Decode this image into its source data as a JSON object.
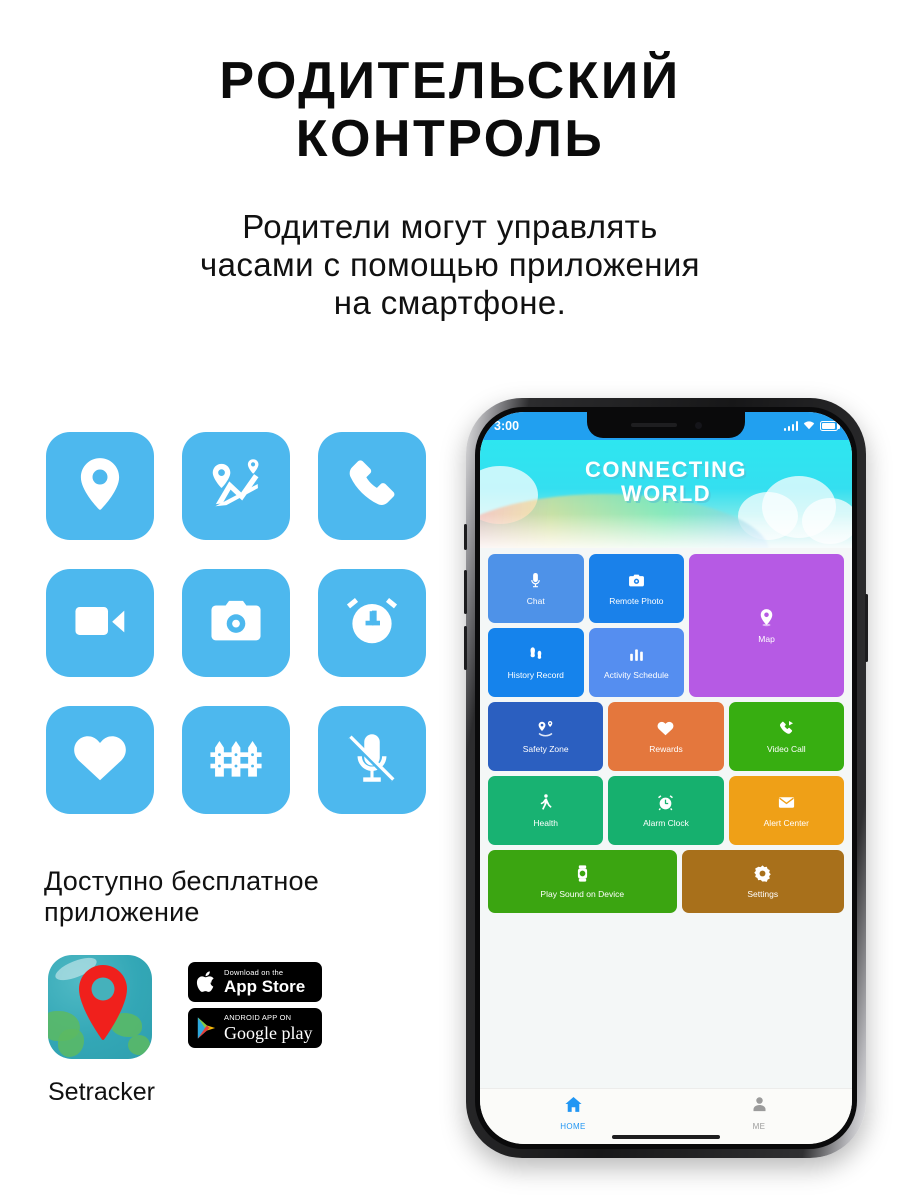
{
  "headline": {
    "line1": "РОДИТЕЛЬСКИЙ",
    "line2": "КОНТРОЛЬ"
  },
  "subhead": {
    "line1": "Родители могут управлять",
    "line2": "часами с помощью приложения",
    "line3": "на смартфоне."
  },
  "feature_icons": [
    {
      "name": "location-pin-icon",
      "label": "Location"
    },
    {
      "name": "route-map-icon",
      "label": "Route tracking"
    },
    {
      "name": "phone-call-icon",
      "label": "Phone call"
    },
    {
      "name": "video-camera-icon",
      "label": "Video call"
    },
    {
      "name": "camera-icon",
      "label": "Remote photo"
    },
    {
      "name": "alarm-clock-icon",
      "label": "Alarm clock"
    },
    {
      "name": "heart-icon",
      "label": "Health"
    },
    {
      "name": "fence-icon",
      "label": "Safety zone"
    },
    {
      "name": "microphone-off-icon",
      "label": "Silent mode"
    }
  ],
  "freeapp": {
    "title_line1": "Доступно бесплатное",
    "title_line2": "приложение",
    "app_name": "Setracker",
    "app_icon_name": "setracker-app-icon",
    "badges": [
      {
        "id": "app-store",
        "small": "Download on the",
        "big": "App Store"
      },
      {
        "id": "google-play",
        "small": "ANDROID APP ON",
        "big": "Google play"
      }
    ]
  },
  "phone": {
    "status": {
      "time": "3:00",
      "signal": "signal-bars-icon",
      "wifi": "wifi-icon",
      "battery": "battery-icon"
    },
    "banner": {
      "line1": "CONNECTING",
      "line2": "WORLD"
    },
    "tiles_group_a": [
      {
        "label": "Chat",
        "icon": "microphone-icon",
        "color": "#4e92e8"
      },
      {
        "label": "Remote Photo",
        "icon": "camera-icon",
        "color": "#1a81ea"
      },
      {
        "label": "Map",
        "icon": "map-pin-icon",
        "color": "#b65ae4",
        "tall": true
      },
      {
        "label": "History Record",
        "icon": "footprints-icon",
        "color": "#1583ec"
      },
      {
        "label": "Activity Schedule",
        "icon": "bar-chart-icon",
        "color": "#558ef0"
      }
    ],
    "tiles_group_b": [
      {
        "label": "Safety Zone",
        "icon": "safety-zone-icon",
        "color": "#2b5fc0"
      },
      {
        "label": "Rewards",
        "icon": "heart-icon",
        "color": "#e4773d"
      },
      {
        "label": "Video Call",
        "icon": "video-call-icon",
        "color": "#37ae11"
      },
      {
        "label": "Health",
        "icon": "walking-icon",
        "color": "#18b272"
      },
      {
        "label": "Alarm Clock",
        "icon": "alarm-clock-icon",
        "color": "#16b06e"
      },
      {
        "label": "Alert Center",
        "icon": "envelope-icon",
        "color": "#efa017"
      }
    ],
    "tiles_group_c": [
      {
        "label": "Play Sound on Device",
        "icon": "smartwatch-icon",
        "color": "#3ba511"
      },
      {
        "label": "Settings",
        "icon": "gear-icon",
        "color": "#a8701b"
      }
    ],
    "bottom_nav": [
      {
        "label": "HOME",
        "icon": "home-icon",
        "active": true
      },
      {
        "label": "ME",
        "icon": "person-icon",
        "active": false
      }
    ]
  },
  "colors": {
    "feature_tile_blue": "#4db8ee",
    "status_bar_blue": "#21a0f0",
    "nav_active_blue": "#2196f3",
    "banner_cyan": "#2ee6f0"
  }
}
